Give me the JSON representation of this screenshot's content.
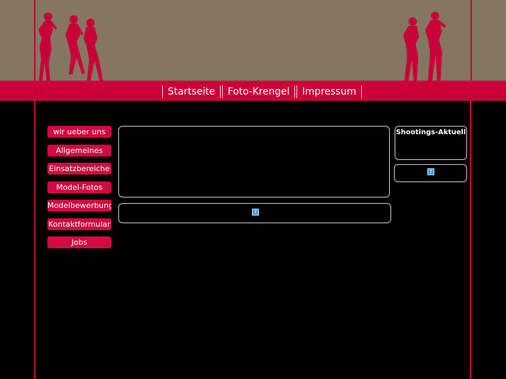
{
  "colors": {
    "header_bg": "#857661",
    "accent_red": "#cc0038",
    "silhouette": "#c8003a",
    "page_bg": "#000000"
  },
  "nav": {
    "items": [
      "Startseite",
      "Foto-Krengel",
      "Impressum"
    ]
  },
  "sidebar": {
    "items": [
      {
        "label": "wir ueber uns"
      },
      {
        "label": "Allgemeines"
      },
      {
        "label": "Einsatzbereiche"
      },
      {
        "label": "Model-Fotos"
      },
      {
        "label": "Modelbewerbung"
      },
      {
        "label": "Kontaktformular"
      },
      {
        "label": "Jobs"
      }
    ]
  },
  "right_panel": {
    "title": "Shootings-Aktuell"
  },
  "icons": {
    "broken_image": "broken-image-icon",
    "silhouettes": "woman-silhouette-icon"
  }
}
